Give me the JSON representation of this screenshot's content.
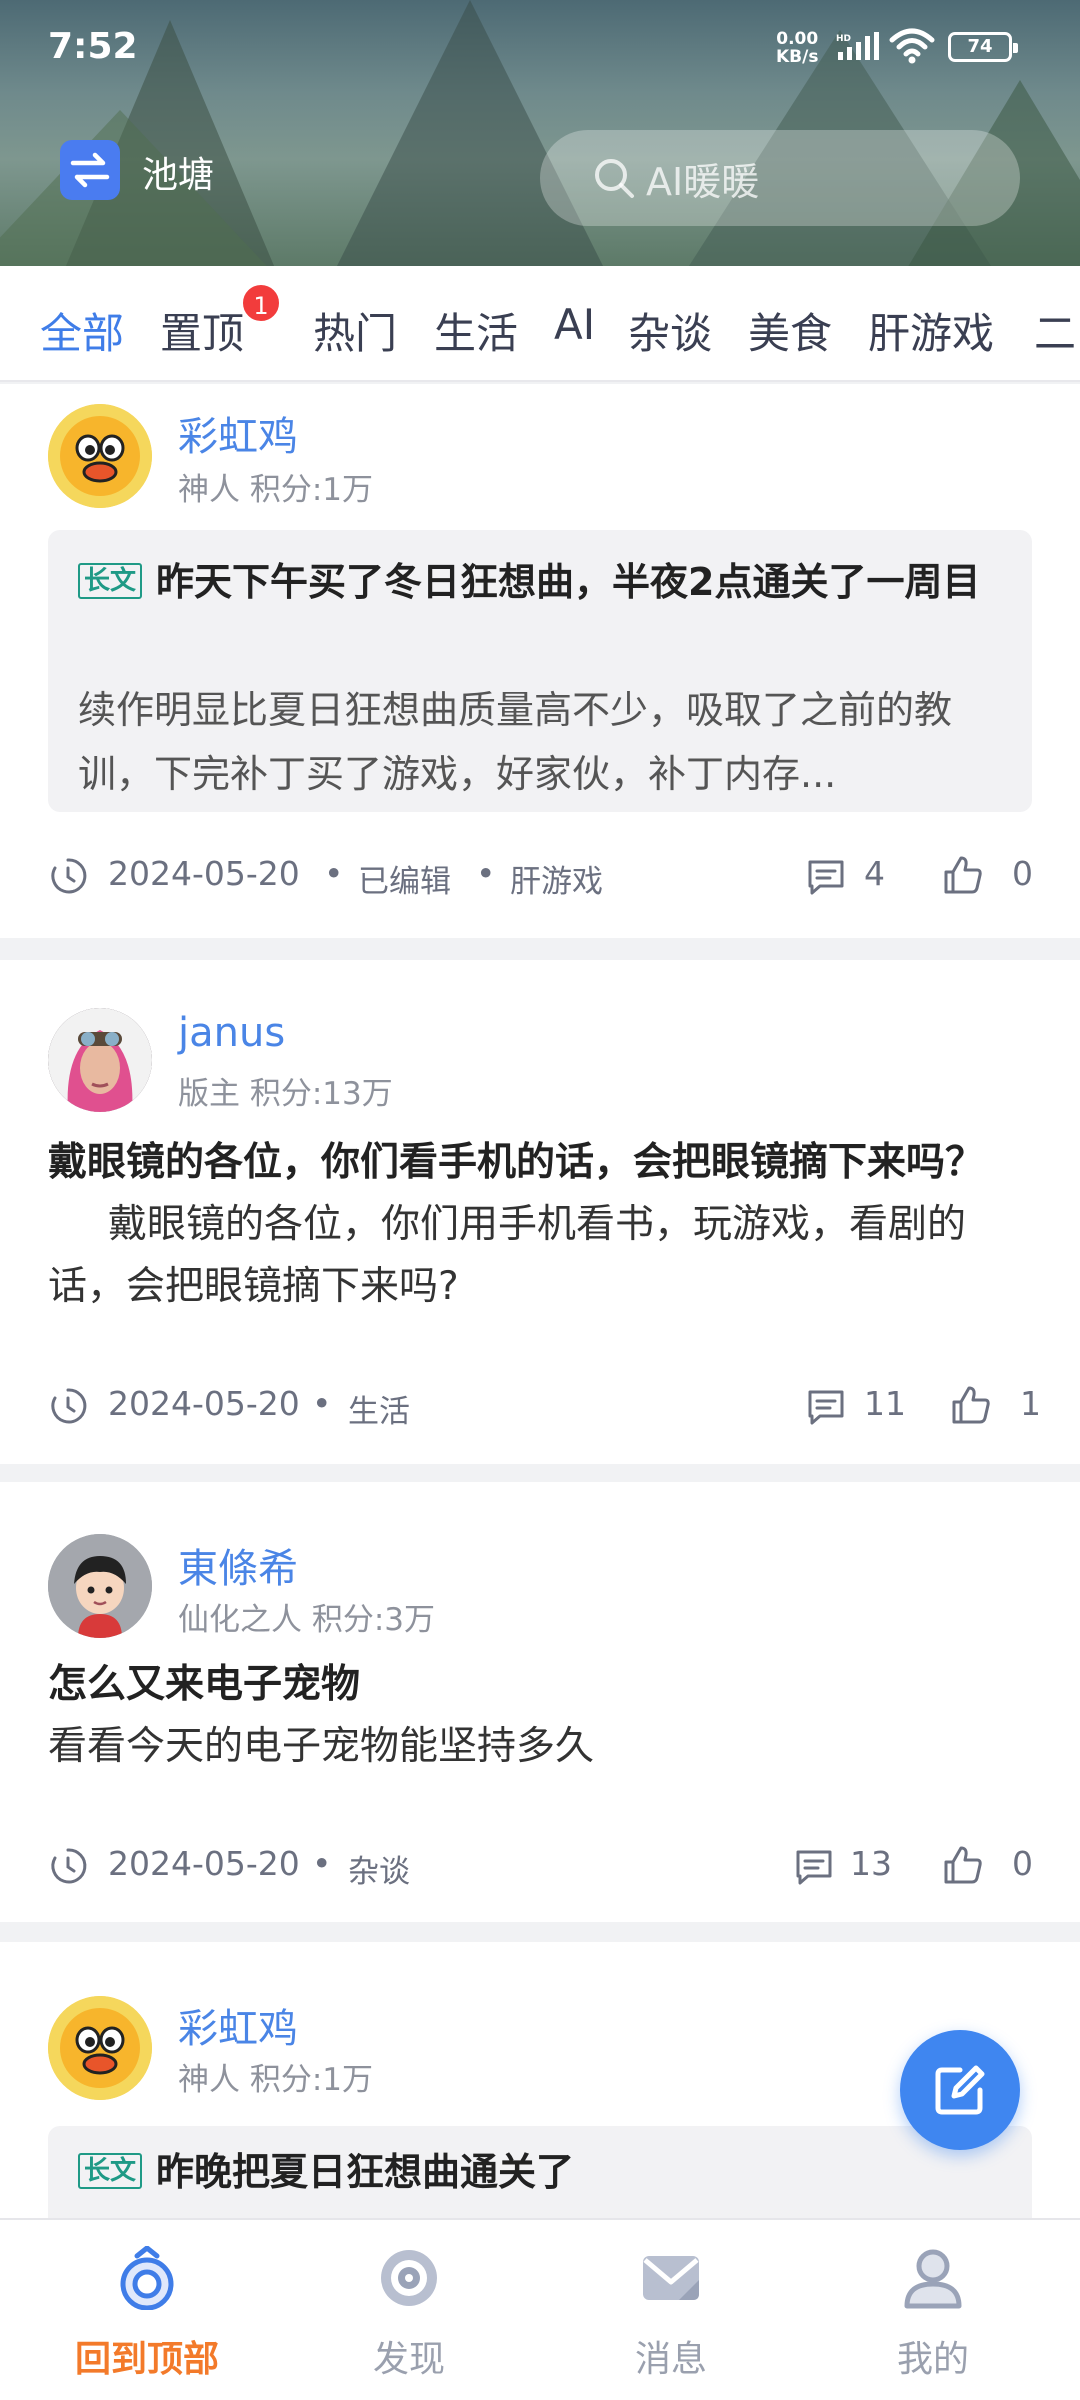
{
  "status_bar": {
    "time": "7:52",
    "net_speed": "0.00",
    "net_unit": "KB/s",
    "hd": "HD",
    "battery": "74"
  },
  "header": {
    "switch_label": "池塘",
    "search_placeholder": "AI暖暖"
  },
  "tabs": [
    {
      "label": "全部",
      "active": true
    },
    {
      "label": "置顶",
      "badge": "1"
    },
    {
      "label": "热门"
    },
    {
      "label": "生活"
    },
    {
      "label": "AI"
    },
    {
      "label": "杂谈"
    },
    {
      "label": "美食"
    },
    {
      "label": "肝游戏"
    },
    {
      "label": "二"
    }
  ],
  "posts": [
    {
      "author": "彩虹鸡",
      "meta": "神人 积分:1万",
      "tag": "长文",
      "title": "昨天下午买了冬日狂想曲，半夜2点通关了一周目",
      "body": " 续作明显比夏日狂想曲质量高不少，吸取了之前的教训，下完补丁买了游戏，好家伙，补丁内存...",
      "date": "2024-05-20",
      "edited": "已编辑",
      "category": "肝游戏",
      "comments": "4",
      "likes": "0"
    },
    {
      "author": "janus",
      "meta": "版主 积分:13万",
      "title": "戴眼镜的各位，你们看手机的话，会把眼镜摘下来吗？",
      "body": "戴眼镜的各位，你们用手机看书，玩游戏，看剧的话，会把眼镜摘下来吗?",
      "date": "2024-05-20",
      "category": "生活",
      "comments": "11",
      "likes": "1"
    },
    {
      "author": "東條希",
      "meta": "仙化之人 积分:3万",
      "title": "怎么又来电子宠物",
      "body": "看看今天的电子宠物能坚持多久",
      "date": "2024-05-20",
      "category": "杂谈",
      "comments": "13",
      "likes": "0"
    },
    {
      "author": "彩虹鸡",
      "meta": "神人 积分:1万",
      "tag": "长文",
      "title": "昨晚把夏日狂想曲通关了"
    }
  ],
  "bottom_nav": [
    {
      "label": "回到顶部",
      "icon": "back-to-top-icon",
      "active": true
    },
    {
      "label": "发现",
      "icon": "discover-icon"
    },
    {
      "label": "消息",
      "icon": "message-icon"
    },
    {
      "label": "我的",
      "icon": "profile-icon"
    }
  ],
  "colors": {
    "accent": "#3f7de8",
    "active_nav": "#f37a2a",
    "badge": "#f23c3c",
    "tag": "#1f9a86"
  }
}
